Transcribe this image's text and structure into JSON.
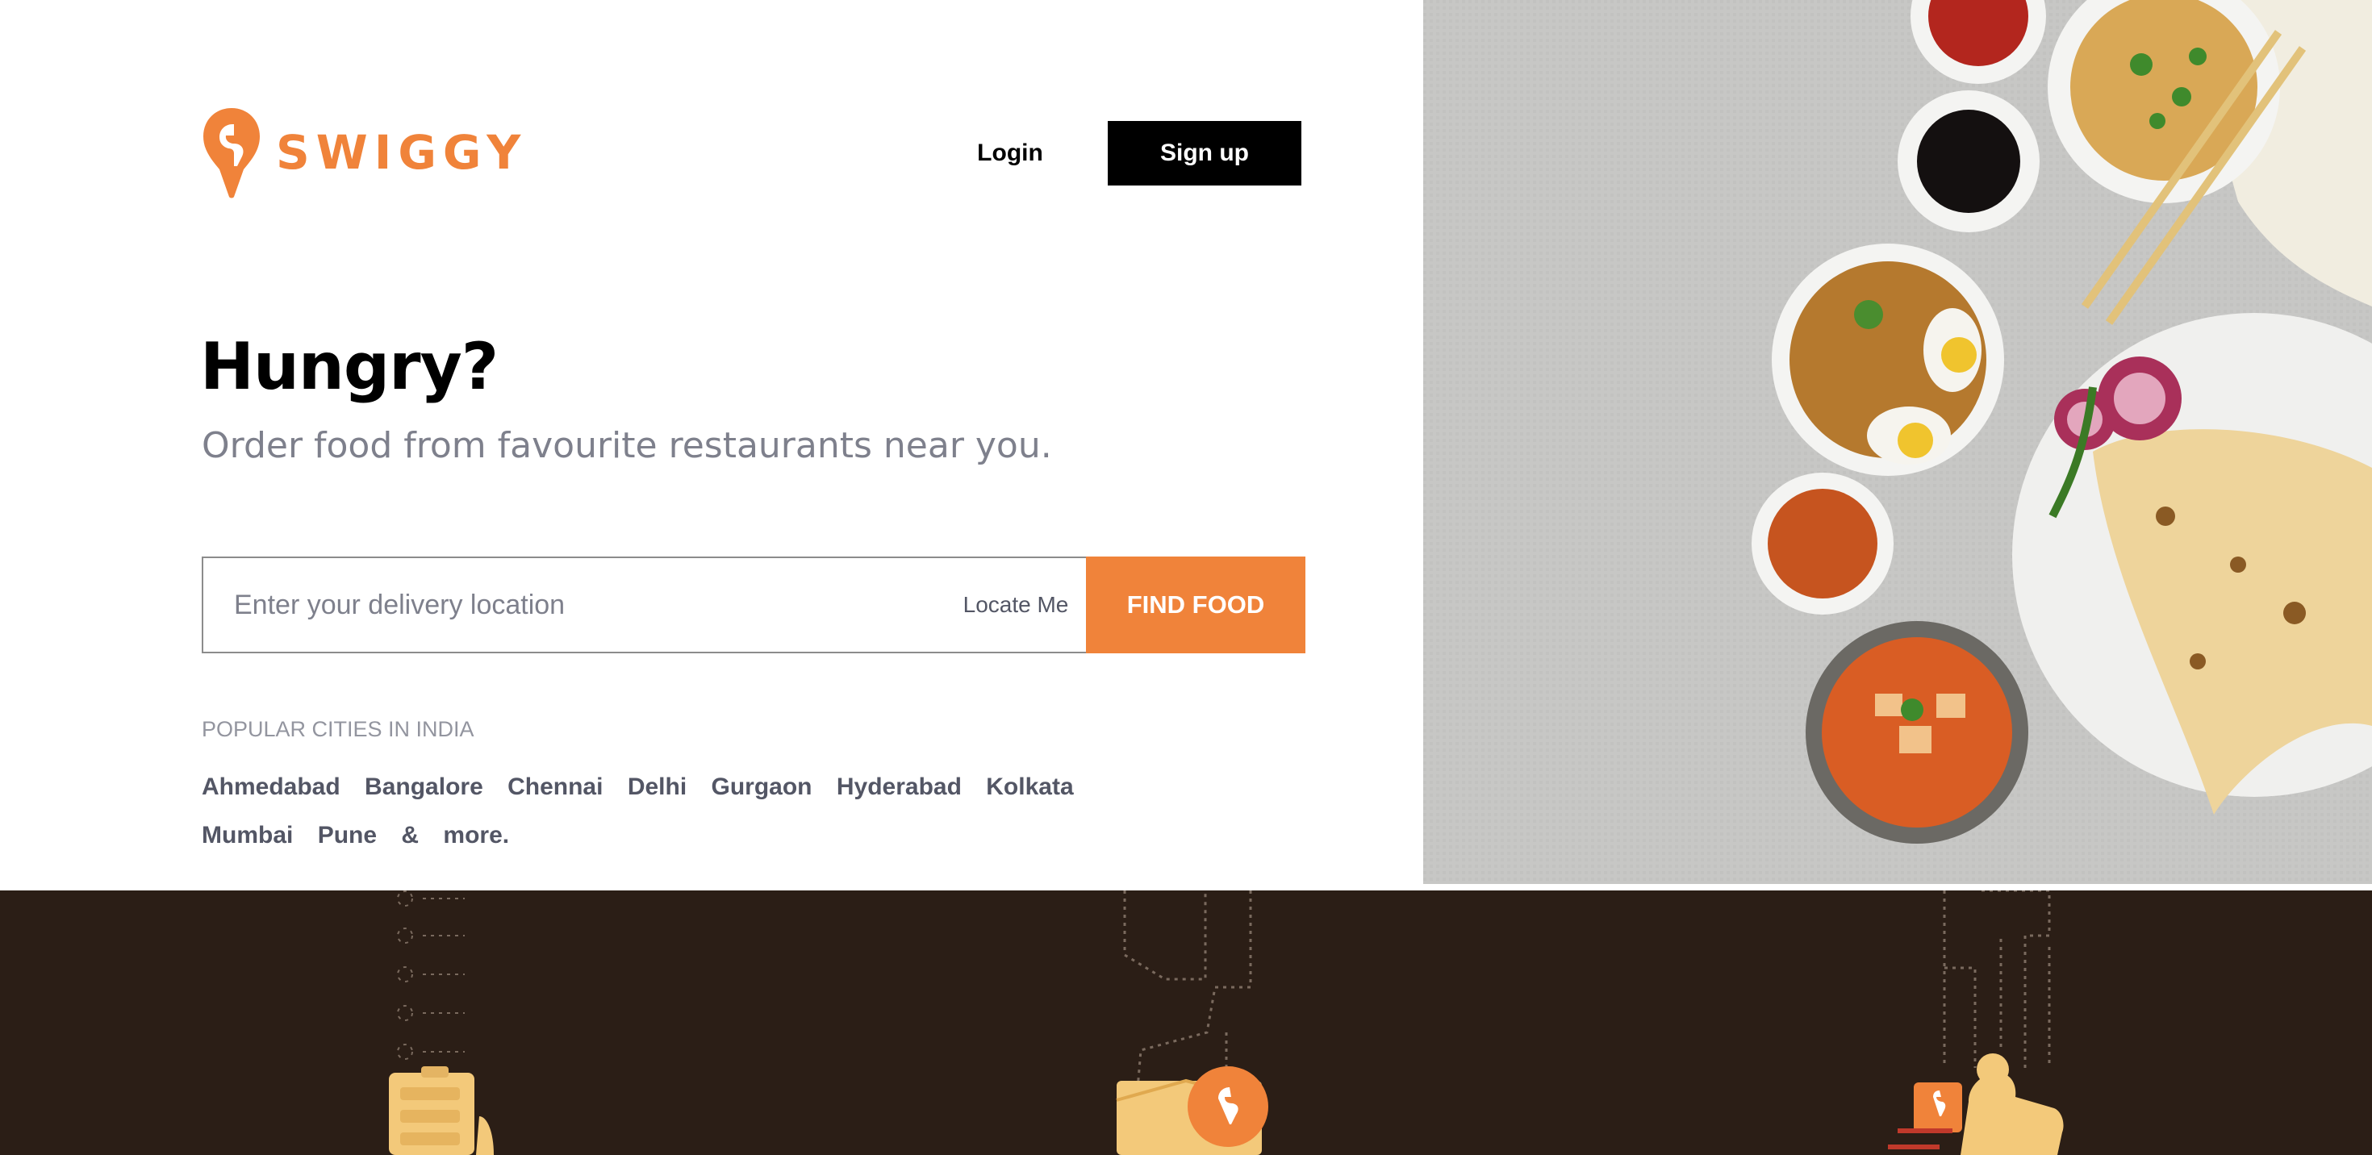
{
  "brand": {
    "name": "SWIGGY",
    "accent_color": "#f0833a",
    "logo_icon": "swiggy-pin-icon"
  },
  "header": {
    "login_label": "Login",
    "signup_label": "Sign up"
  },
  "hero": {
    "title": "Hungry?",
    "subtitle": "Order food from favourite restaurants near you."
  },
  "search": {
    "placeholder": "Enter your delivery location",
    "value": "",
    "locate_label": "Locate Me",
    "submit_label": "FIND FOOD"
  },
  "popular": {
    "title": "POPULAR CITIES IN INDIA",
    "cities": [
      "Ahmedabad",
      "Bangalore",
      "Chennai",
      "Delhi",
      "Gurgaon",
      "Hyderabad",
      "Kolkata",
      "Mumbai",
      "Pune",
      "&",
      "more."
    ]
  },
  "images": {
    "food_photo": "food-spread-image",
    "band_illustrations": [
      "order-list-illustration",
      "delivery-box-pin-illustration",
      "delivery-rider-illustration"
    ]
  },
  "colors": {
    "band_background": "#2b1e16",
    "photo_background": "#c6c6c4",
    "text_muted": "#7e808c"
  }
}
